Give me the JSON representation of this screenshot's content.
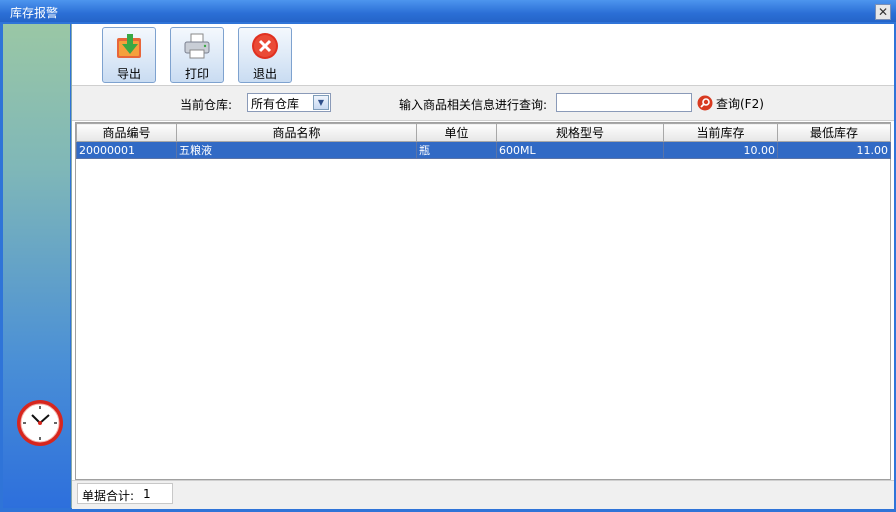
{
  "window": {
    "title": "库存报警",
    "close_glyph": "✕"
  },
  "toolbar": {
    "buttons": [
      {
        "label": "导出",
        "icon": "export-icon"
      },
      {
        "label": "打印",
        "icon": "printer-icon"
      },
      {
        "label": "退出",
        "icon": "exit-icon"
      }
    ]
  },
  "filter": {
    "warehouse_label": "当前仓库:",
    "warehouse_value": "所有仓库",
    "search_label": "输入商品相关信息进行查询:",
    "search_value": "",
    "query_label": "查询(F2)"
  },
  "table": {
    "columns": [
      "商品编号",
      "商品名称",
      "单位",
      "规格型号",
      "当前库存",
      "最低库存"
    ],
    "rows": [
      [
        "20000001",
        "五粮液",
        "瓶",
        "600ML",
        "10.00",
        "11.00"
      ]
    ]
  },
  "footer": {
    "count_label": "单据合计:",
    "count_value": "1"
  },
  "colors": {
    "title_bar": "#2b6fd6",
    "selected_row": "#316ac5",
    "close_icon": "#e03020"
  }
}
